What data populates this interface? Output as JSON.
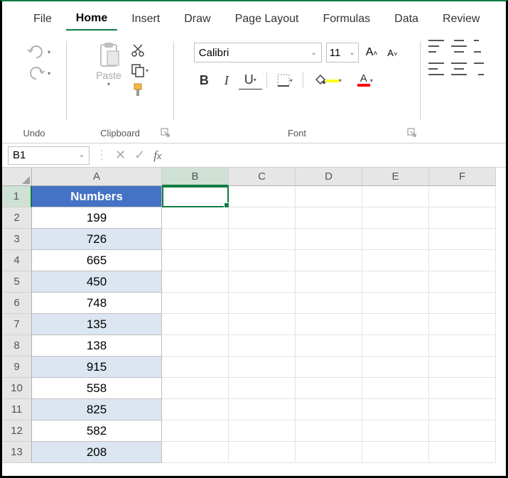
{
  "ribbon": {
    "tabs": [
      "File",
      "Home",
      "Insert",
      "Draw",
      "Page Layout",
      "Formulas",
      "Data",
      "Review"
    ],
    "active_tab": "Home",
    "groups": {
      "undo": "Undo",
      "clipboard": "Clipboard",
      "paste_label": "Paste",
      "font": "Font"
    },
    "font": {
      "name": "Calibri",
      "size": "11",
      "bold": "B",
      "italic": "I",
      "underline": "U"
    }
  },
  "name_box": "B1",
  "formula_value": "",
  "columns": [
    "A",
    "B",
    "C",
    "D",
    "E",
    "F"
  ],
  "selected_col": "B",
  "selected_row": 1,
  "row_count": 13,
  "table": {
    "header": "Numbers",
    "values": [
      199,
      726,
      665,
      450,
      748,
      135,
      138,
      915,
      558,
      825,
      582,
      208
    ]
  }
}
